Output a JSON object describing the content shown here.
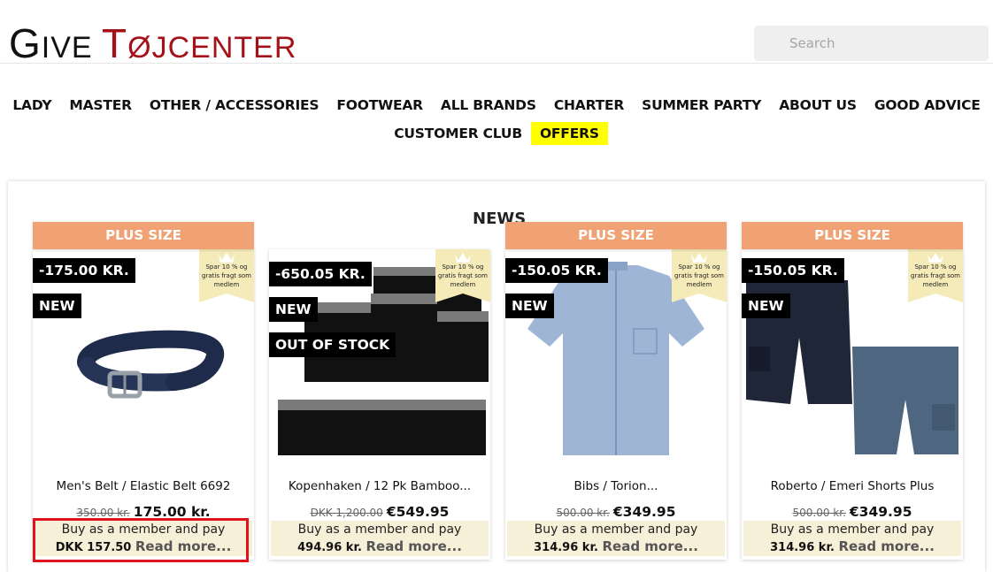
{
  "header": {
    "logo_part1_initial": "G",
    "logo_part1_rest": "IVE",
    "logo_part2_initial": "T",
    "logo_part2_rest": "ØJCENTER",
    "search_placeholder": "Search"
  },
  "nav": {
    "row1": [
      "LADY",
      "MASTER",
      "OTHER / ACCESSORIES",
      "FOOTWEAR",
      "ALL BRANDS",
      "CHARTER",
      "SUMMER PARTY",
      "ABOUT US",
      "GOOD ADVICE"
    ],
    "row2": [
      "CUSTOMER CLUB",
      "OFFERS"
    ]
  },
  "section_title": "NEWS",
  "member_flag_text": "Spar 10 % og gratis fragt som medlem",
  "products": [
    {
      "ribbon": "PLUS SIZE",
      "discount": "-175.00 KR.",
      "new_badge": "NEW",
      "title": "Men's Belt / Elastic Belt 6692",
      "old_price": "350.00 kr.",
      "price": "175.00 kr.",
      "member_line": "Buy as a member and pay",
      "member_price": "DKK 157.50",
      "read_more": "Read more..."
    },
    {
      "ribbon": "",
      "discount": "-650.05 KR.",
      "new_badge": "NEW",
      "stock_badge": "OUT OF STOCK",
      "title": "Kopenhaken / 12 Pk Bamboo...",
      "old_price": "DKK 1,200.00",
      "price": "€549.95",
      "member_line": "Buy as a member and pay",
      "member_price": "494.96 kr.",
      "read_more": "Read more..."
    },
    {
      "ribbon": "PLUS SIZE",
      "discount": "-150.05 KR.",
      "new_badge": "NEW",
      "title": "Bibs / Torion...",
      "old_price": "500.00 kr.",
      "price": "€349.95",
      "member_line": "Buy as a member and pay",
      "member_price": "314.96 kr.",
      "read_more": "Read more..."
    },
    {
      "ribbon": "PLUS SIZE",
      "discount": "-150.05 KR.",
      "new_badge": "NEW",
      "title": "Roberto / Emeri Shorts Plus",
      "old_price": "500.00 kr.",
      "price": "€349.95",
      "member_line": "Buy as a member and pay",
      "member_price": "314.96 kr.",
      "read_more": "Read more..."
    }
  ],
  "colors": {
    "brand_red": "#a31218",
    "ribbon_orange": "#f0a274",
    "offers_highlight": "#ffff00",
    "member_bg": "#f6f0d8",
    "highlight_box": "#e0121b"
  }
}
